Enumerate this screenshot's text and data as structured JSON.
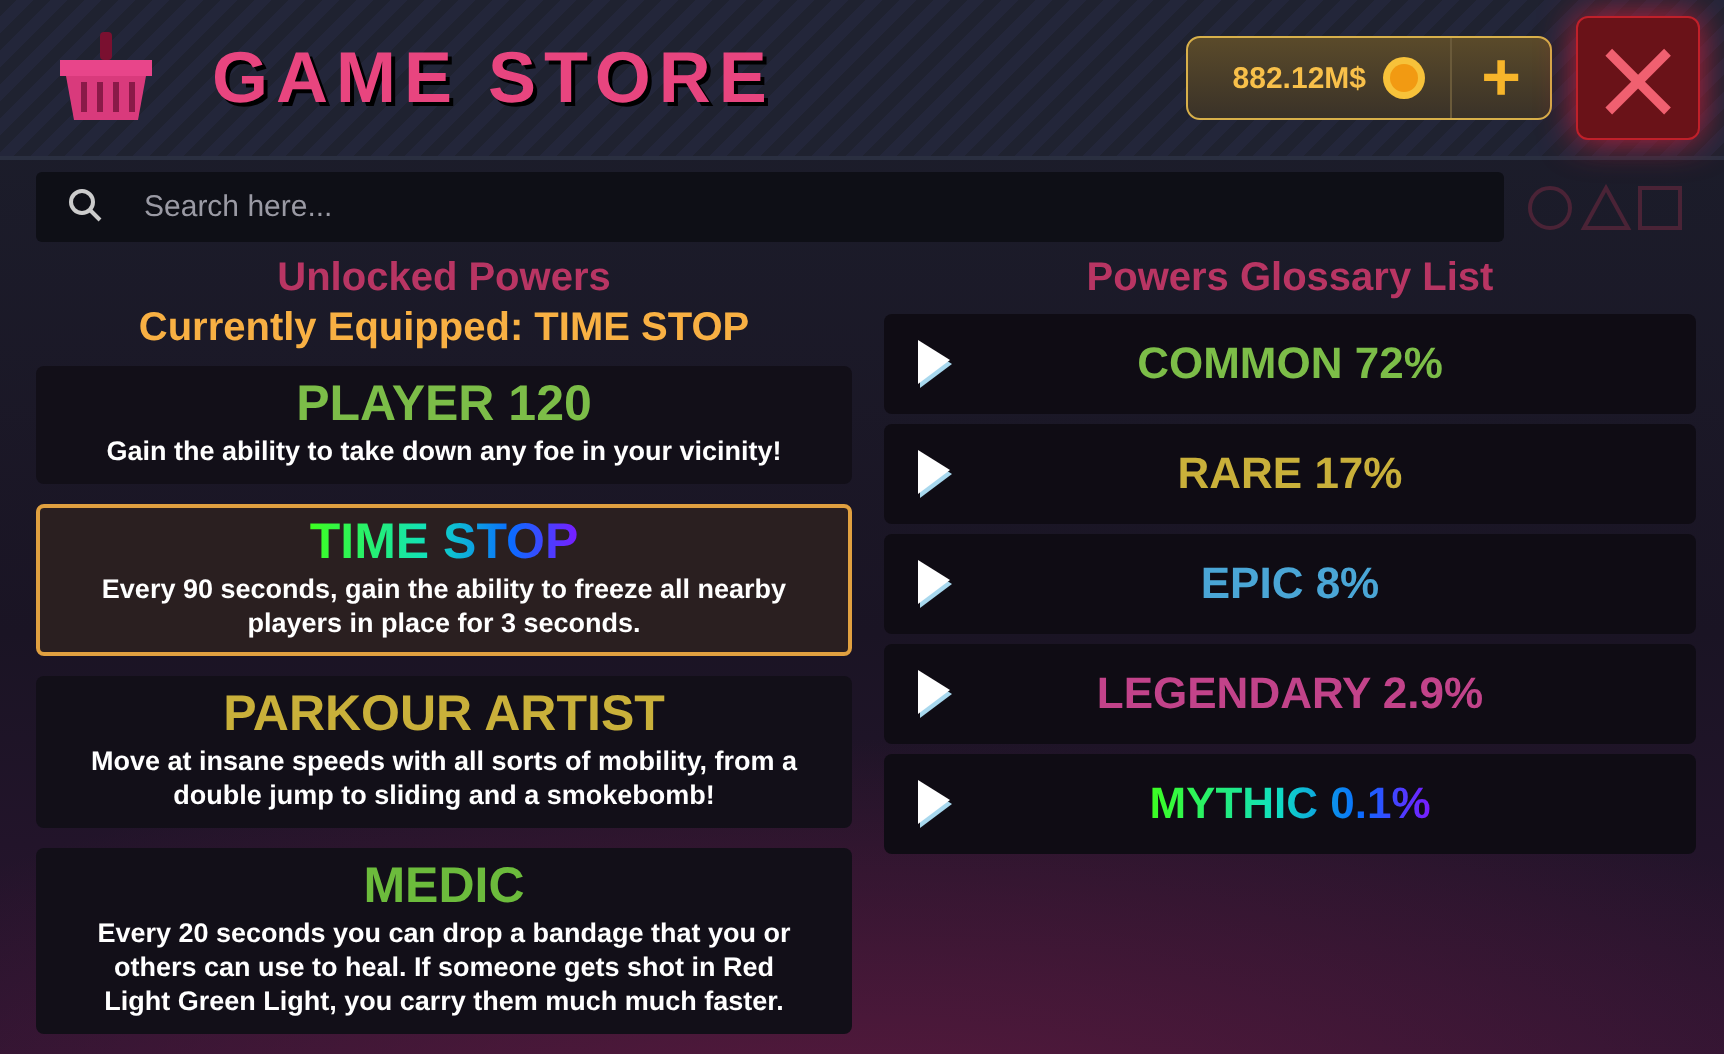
{
  "header": {
    "title": "GAME STORE",
    "balance": "882.12M$",
    "add_button": "+",
    "close_button": "×"
  },
  "search": {
    "placeholder": "Search here..."
  },
  "unlocked": {
    "heading": "Unlocked Powers",
    "equipped": "Currently Equipped: TIME STOP",
    "powers": [
      {
        "name": "PLAYER 120",
        "kind": "solid",
        "color": "#7cbd48",
        "description": "Gain the ability to take down any foe in your vicinity!",
        "selected": false
      },
      {
        "name": "TIME STOP",
        "kind": "gradient",
        "description": "Every 90 seconds, gain the ability to freeze all nearby players in place for 3 seconds.",
        "selected": true
      },
      {
        "name": "PARKOUR ARTIST",
        "kind": "solid",
        "color": "#c9b03a",
        "description": "Move at insane speeds with all sorts of mobility, from a double jump to sliding and a smokebomb!",
        "selected": false
      },
      {
        "name": "MEDIC",
        "kind": "solid",
        "color": "#6cbb3c",
        "description": "Every 20 seconds you can drop a bandage that you or others can use to heal. If someone gets shot in Red Light Green Light, you carry them much much faster.",
        "selected": false
      }
    ]
  },
  "glossary": {
    "heading": "Powers Glossary List",
    "rarities": [
      {
        "label": "COMMON 72%",
        "kind": "solid",
        "color": "#7cbd48"
      },
      {
        "label": "RARE 17%",
        "kind": "solid",
        "color": "#c9b03a"
      },
      {
        "label": "EPIC 8%",
        "kind": "solid",
        "color": "#4aa6d6"
      },
      {
        "label": "LEGENDARY 2.9%",
        "kind": "solid",
        "color": "#c2438a"
      },
      {
        "label": "MYTHIC 0.1%",
        "kind": "gradient"
      }
    ]
  }
}
